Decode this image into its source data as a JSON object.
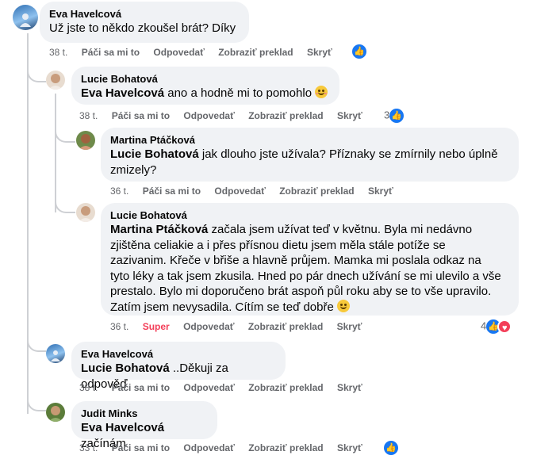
{
  "comments": [
    {
      "author": "Eva Havelcová",
      "text": "Už jste to někdo zkoušel brát? Díky",
      "time": "38 t.",
      "like": "Páči sa mi to",
      "reply": "Odpovedať",
      "translate": "Zobraziť preklad",
      "hide": "Skryť"
    },
    {
      "author": "Lucie Bohatová",
      "mention": "Eva Havelcová",
      "text": " ano a hodně mi to pomohlo",
      "time": "38 t.",
      "like": "Páči sa mi to",
      "reply": "Odpovedať",
      "translate": "Zobraziť preklad",
      "hide": "Skryť",
      "reactions": "3"
    },
    {
      "author": "Martina Ptáčková",
      "mention": "Lucie Bohatová",
      "text": " jak dlouho jste užívala? Příznaky se zmírnily nebo úplně",
      "text2": "zmizely?",
      "time": "36 t.",
      "like": "Páči sa mi to",
      "reply": "Odpovedať",
      "translate": "Zobraziť preklad",
      "hide": "Skryť"
    },
    {
      "author": "Lucie Bohatová",
      "mention": "Martina Ptáčková",
      "line1": " začala jsem užívat teď v květnu. Byla mi nedávno",
      "line2": "zjištěna celiakie a i přes přísnou dietu jsem měla stále potíže se",
      "line3": "zazivanim. Křeče v břiše a hlavně průjem. Mamka mi poslala odkaz na",
      "line4": "tyto léky a tak jsem zkusila. Hned po pár dnech užívání se mi ulevilo a vše",
      "line5": "prestalo. Bylo mi doporučeno brát aspoň půl roku aby se to vše upravilo.",
      "line6": "Zatím jsem nevysadila. Cítím se teď dobře",
      "time": "36 t.",
      "like": "Super",
      "reply": "Odpovedať",
      "translate": "Zobraziť preklad",
      "hide": "Skryť",
      "reactions": "4"
    },
    {
      "author": "Eva Havelcová",
      "mention": "Lucie Bohatová",
      "text": " ..Děkuji za odpověď",
      "time": "38 t.",
      "like": "Páči sa mi to",
      "reply": "Odpovedať",
      "translate": "Zobraziť preklad",
      "hide": "Skryť"
    },
    {
      "author": "Judit Minks",
      "mention": "Eva Havelcová",
      "text": " začínám",
      "time": "33 t.",
      "like": "Páči sa mi to",
      "reply": "Odpovedať",
      "translate": "Zobraziť preklad",
      "hide": "Skryť"
    }
  ],
  "icons": {
    "like": "thumbs-up-icon",
    "love": "heart-icon",
    "emoji": "smiling-face-icon"
  },
  "colors": {
    "like": "#1877f2",
    "love": "#f33e58",
    "bubble": "#f0f2f5",
    "meta": "#65676b"
  }
}
